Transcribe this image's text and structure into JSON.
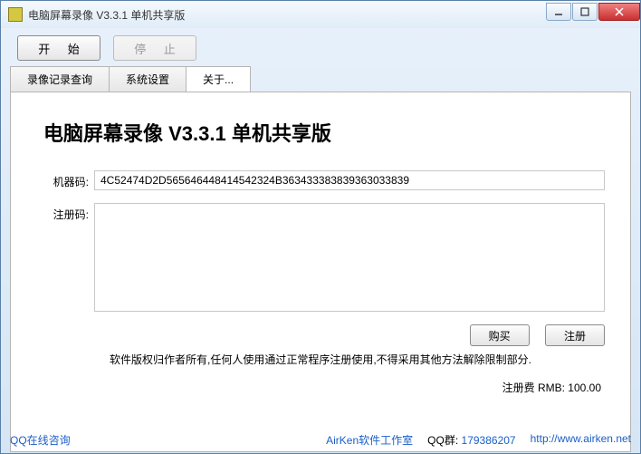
{
  "window": {
    "title": "电脑屏幕录像 V3.3.1 单机共享版"
  },
  "toolbar": {
    "start": "开 始",
    "stop": "停 止"
  },
  "tabs": {
    "records": "录像记录查询",
    "settings": "系统设置",
    "about": "关于..."
  },
  "about": {
    "heading": "电脑屏幕录像 V3.3.1 单机共享版",
    "machine_label": "机器码:",
    "machine_code": "4C52474D2D565646448414542324B363433383839363033839",
    "reg_label": "注册码:",
    "reg_code": "",
    "buy": "购买",
    "register": "注册",
    "copyright": "软件版权归作者所有,任何人使用通过正常程序注册使用,不得采用其他方法解除限制部分.",
    "fee": "注册费 RMB: 100.00"
  },
  "footer": {
    "qq_consult": "QQ在线咨询",
    "studio": "AirKen软件工作室",
    "qq_group_label": "QQ群:",
    "qq_group": "179386207",
    "url": "http://www.airken.net"
  }
}
